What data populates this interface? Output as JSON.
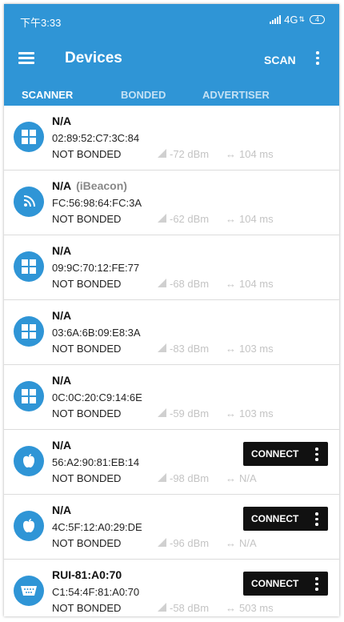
{
  "status_bar": {
    "time": "下午3:33",
    "network": "4G",
    "battery": "4"
  },
  "app_bar": {
    "title": "Devices",
    "scan_label": "SCAN"
  },
  "tabs": [
    {
      "label": "SCANNER",
      "active": true
    },
    {
      "label": "BONDED",
      "active": false
    },
    {
      "label": "ADVERTISER",
      "active": false
    }
  ],
  "colors": {
    "primary": "#2f95d6",
    "connect_button": "#111111",
    "muted_text": "#c4c4c4"
  },
  "devices": [
    {
      "icon": "windows-icon",
      "name": "N/A",
      "type": "",
      "mac": "02:89:52:C7:3C:84",
      "bond": "NOT BONDED",
      "rssi": "-72 dBm",
      "interval": "104 ms",
      "connect": ""
    },
    {
      "icon": "beacon-icon",
      "name": "N/A",
      "type": "(iBeacon)",
      "mac": "FC:56:98:64:FC:3A",
      "bond": "NOT BONDED",
      "rssi": "-62 dBm",
      "interval": "104 ms",
      "connect": ""
    },
    {
      "icon": "windows-icon",
      "name": "N/A",
      "type": "",
      "mac": "09:9C:70:12:FE:77",
      "bond": "NOT BONDED",
      "rssi": "-68 dBm",
      "interval": "104 ms",
      "connect": ""
    },
    {
      "icon": "windows-icon",
      "name": "N/A",
      "type": "",
      "mac": "03:6A:6B:09:E8:3A",
      "bond": "NOT BONDED",
      "rssi": "-83 dBm",
      "interval": "103 ms",
      "connect": ""
    },
    {
      "icon": "windows-icon",
      "name": "N/A",
      "type": "",
      "mac": "0C:0C:20:C9:14:6E",
      "bond": "NOT BONDED",
      "rssi": "-59 dBm",
      "interval": "103 ms",
      "connect": ""
    },
    {
      "icon": "apple-icon",
      "name": "N/A",
      "type": "",
      "mac": "56:A2:90:81:EB:14",
      "bond": "NOT BONDED",
      "rssi": "-98 dBm",
      "interval": "N/A",
      "connect": "CONNECT"
    },
    {
      "icon": "apple-icon",
      "name": "N/A",
      "type": "",
      "mac": "4C:5F:12:A0:29:DE",
      "bond": "NOT BONDED",
      "rssi": "-96 dBm",
      "interval": "N/A",
      "connect": "CONNECT"
    },
    {
      "icon": "serial-port-icon",
      "name": "RUI-81:A0:70",
      "type": "",
      "mac": "C1:54:4F:81:A0:70",
      "bond": "NOT BONDED",
      "rssi": "-58 dBm",
      "interval": "503 ms",
      "connect": "CONNECT"
    }
  ]
}
